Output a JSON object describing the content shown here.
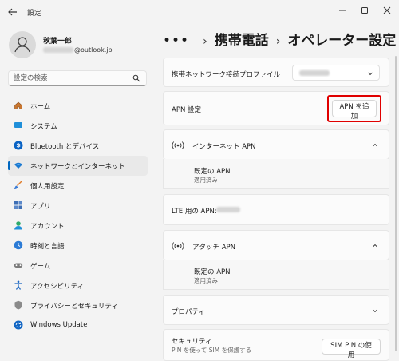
{
  "window": {
    "back_icon": "back-arrow-icon",
    "title": "設定",
    "controls": [
      "minimize-icon",
      "maximize-icon",
      "close-icon"
    ]
  },
  "profile": {
    "name": "秋葉一郎",
    "email_suffix": "@outlook.jp"
  },
  "search": {
    "placeholder": "設定の検索"
  },
  "nav": {
    "items": [
      {
        "label": "ホーム",
        "icon": "home-icon"
      },
      {
        "label": "システム",
        "icon": "system-display-icon"
      },
      {
        "label": "Bluetooth とデバイス",
        "icon": "bluetooth-icon"
      },
      {
        "label": "ネットワークとインターネット",
        "icon": "wifi-network-icon",
        "active": true
      },
      {
        "label": "個人用設定",
        "icon": "brush-icon"
      },
      {
        "label": "アプリ",
        "icon": "apps-icon"
      },
      {
        "label": "アカウント",
        "icon": "account-icon"
      },
      {
        "label": "時刻と言語",
        "icon": "time-language-icon"
      },
      {
        "label": "ゲーム",
        "icon": "gamepad-icon"
      },
      {
        "label": "アクセシビリティ",
        "icon": "accessibility-icon"
      },
      {
        "label": "プライバシーとセキュリティ",
        "icon": "shield-icon"
      },
      {
        "label": "Windows Update",
        "icon": "windows-update-icon"
      }
    ]
  },
  "breadcrumb": {
    "dots": "•••",
    "parent": "携帯電話",
    "current": "オペレーター設定"
  },
  "main": {
    "profile_row": {
      "label": "携帯ネットワーク接続プロファイル"
    },
    "apn_settings": {
      "label": "APN 設定",
      "add_button": "APN を追加"
    },
    "internet_apn": {
      "label": "インターネット APN",
      "default_label": "既定の APN",
      "status": "適用済み"
    },
    "lte_apn": {
      "label": "LTE 用の APN:"
    },
    "attach_apn": {
      "label": "アタッチ APN",
      "default_label": "既定の APN",
      "status": "適用済み"
    },
    "properties": {
      "label": "プロパティ"
    },
    "security": {
      "label": "セキュリティ",
      "description": "PIN を使って SIM を保護する",
      "button": "SIM PIN の使用"
    }
  },
  "colors": {
    "accent": "#0067c0",
    "highlight_box": "#e00000"
  }
}
